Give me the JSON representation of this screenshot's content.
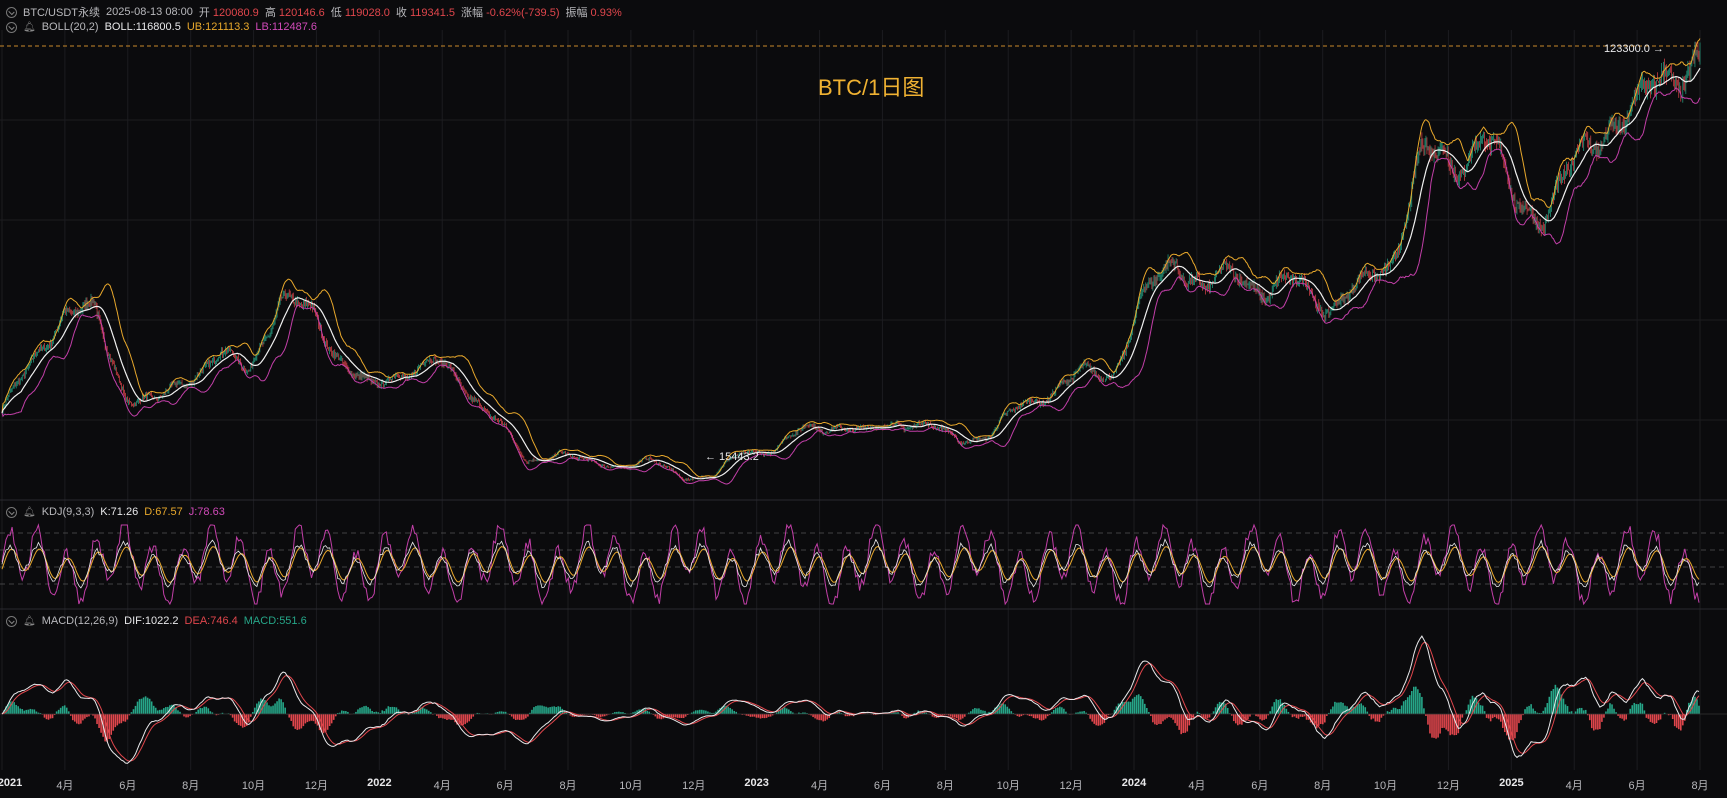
{
  "header": {
    "symbol": "BTC/USDT永续",
    "datetime": "2025-08-13 08:00",
    "open_label": "开",
    "open": "120080.9",
    "high_label": "高",
    "high": "120146.6",
    "low_label": "低",
    "low": "119028.0",
    "close_label": "收",
    "close": "119341.5",
    "change_label": "涨幅",
    "change": "-0.62%(-739.5)",
    "amp_label": "振幅",
    "amp": "0.93%"
  },
  "boll": {
    "name": "BOLL(20,2)",
    "mid": "BOLL:116800.5",
    "ub": "UB:121113.3",
    "lb": "LB:112487.6"
  },
  "kdj": {
    "name": "KDJ(9,3,3)",
    "k": "K:71.26",
    "d": "D:67.57",
    "j": "J:78.63"
  },
  "macd": {
    "name": "MACD(12,26,9)",
    "dif": "DIF:1022.2",
    "dea": "DEA:746.4",
    "macd": "MACD:551.6"
  },
  "chart_title": "BTC/1日图",
  "markers": {
    "high": "123300.0 →",
    "low": "← 15443.2"
  },
  "colors": {
    "up": "#26a688",
    "down": "#e0464c",
    "mid": "#f0f0f0",
    "ub": "#e8a82c",
    "lb": "#c23fa8",
    "title": "#f0b232"
  },
  "chart_data": {
    "type": "candlestick",
    "title": "BTC/1日图",
    "x": [
      "2021-01",
      "2021-02",
      "2021-03",
      "2021-04",
      "2021-05",
      "2021-06",
      "2021-07",
      "2021-08",
      "2021-09",
      "2021-10",
      "2021-11",
      "2021-12",
      "2022-01",
      "2022-02",
      "2022-03",
      "2022-04",
      "2022-05",
      "2022-06",
      "2022-07",
      "2022-08",
      "2022-09",
      "2022-10",
      "2022-11",
      "2022-12",
      "2023-01",
      "2023-02",
      "2023-03",
      "2023-04",
      "2023-05",
      "2023-06",
      "2023-07",
      "2023-08",
      "2023-09",
      "2023-10",
      "2023-11",
      "2023-12",
      "2024-01",
      "2024-02",
      "2024-03",
      "2024-04",
      "2024-05",
      "2024-06",
      "2024-07",
      "2024-08",
      "2024-09",
      "2024-10",
      "2024-11",
      "2024-12",
      "2025-01",
      "2025-02",
      "2025-03",
      "2025-04",
      "2025-05",
      "2025-06",
      "2025-07",
      "2025-08"
    ],
    "close": [
      33000,
      45000,
      58000,
      57000,
      37000,
      35000,
      41000,
      47000,
      43000,
      61000,
      57000,
      46000,
      38000,
      43000,
      45500,
      38500,
      31500,
      20000,
      23000,
      20000,
      19500,
      20500,
      17000,
      16500,
      23000,
      23500,
      28500,
      29500,
      27500,
      30500,
      29200,
      26000,
      27000,
      34500,
      37700,
      42300,
      42500,
      61000,
      71000,
      63000,
      67500,
      62700,
      64600,
      59000,
      63300,
      70200,
      96500,
      93500,
      102400,
      84300,
      82500,
      94200,
      104600,
      107100,
      117800,
      119341.5
    ],
    "axis_labels": [
      "2021",
      "4月",
      "6月",
      "8月",
      "10月",
      "12月",
      "2022",
      "4月",
      "6月",
      "8月",
      "10月",
      "12月",
      "2023",
      "4月",
      "6月",
      "8月",
      "10月",
      "12月",
      "2024",
      "4月",
      "6月",
      "8月",
      "10月",
      "12月",
      "2025",
      "4月",
      "6月",
      "8月"
    ],
    "annotations": {
      "high": 123300.0,
      "low": 15443.2
    },
    "indicators": [
      "BOLL(20,2)",
      "KDJ(9,3,3)",
      "MACD(12,26,9)"
    ]
  }
}
